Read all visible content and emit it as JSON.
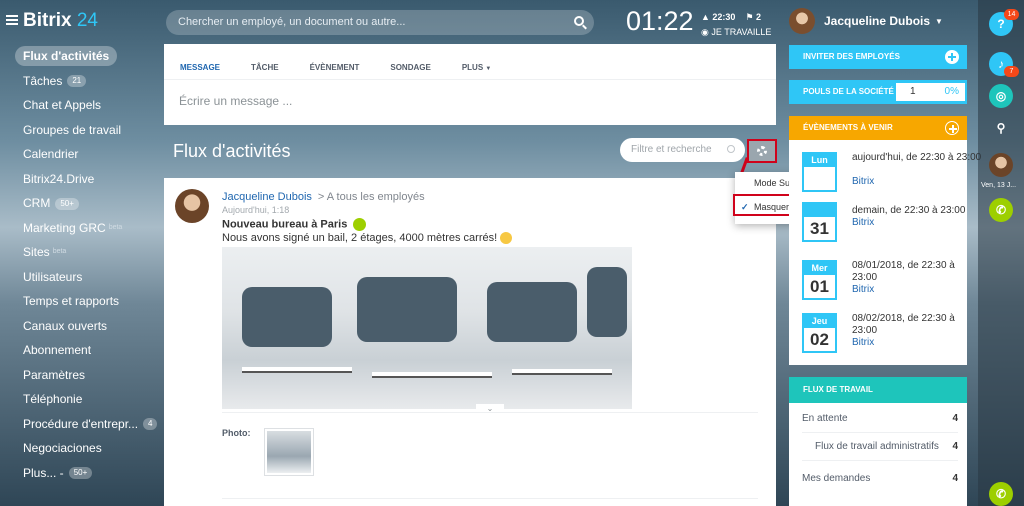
{
  "top": {
    "logo_name": "Bitrix",
    "logo_num": "24",
    "search_placeholder": "Chercher un employé, un document ou autre...",
    "clock": "01:22",
    "alarm_time": "22:30",
    "flags": "2",
    "work_status": "JE TRAVAILLE",
    "user_name": "Jacqueline Dubois"
  },
  "left_menu": [
    {
      "label": "Flux d'activités",
      "active": true
    },
    {
      "label": "Tâches",
      "count": "21"
    },
    {
      "label": "Chat et Appels"
    },
    {
      "label": "Groupes de travail"
    },
    {
      "label": "Calendrier"
    },
    {
      "label": "Bitrix24.Drive"
    },
    {
      "label": "CRM",
      "count": "50+"
    },
    {
      "label": "Marketing GRC",
      "beta": "beta"
    },
    {
      "label": "Sites",
      "beta": "beta"
    },
    {
      "label": "Utilisateurs"
    },
    {
      "label": "Temps et rapports"
    },
    {
      "label": "Canaux ouverts"
    },
    {
      "label": "Abonnement"
    },
    {
      "label": "Paramètres"
    },
    {
      "label": "Téléphonie"
    },
    {
      "label": "Procédure d'entrepr...",
      "count": "4"
    },
    {
      "label": "Negociaciones"
    },
    {
      "label": "Plus... -",
      "count": "50+"
    }
  ],
  "composer": {
    "tabs": [
      "MESSAGE",
      "TÂCHE",
      "ÉVÈNEMENT",
      "SONDAGE",
      "PLUS"
    ],
    "placeholder": "Écrire un message ..."
  },
  "feed": {
    "title": "Flux d'activités",
    "filter_placeholder": "Filtre et recherche"
  },
  "popup": {
    "item1": "Mode Suivi intelligent",
    "item2": "Masquer les tâches"
  },
  "post": {
    "author": "Jacqueline Dubois",
    "destination": "A tous les employés",
    "date": "Aujourd'hui, 1:18",
    "title": "Nouveau bureau à Paris",
    "text": "Nous avons signé un bail, 2 étages, 4000 mètres carrés!",
    "photo_label": "Photo:"
  },
  "right": {
    "invite": "INVITER DES EMPLOYÉS",
    "pouls": "POULS DE LA SOCIÉTÉ",
    "pouls_value": "1",
    "pouls_pct": "0%",
    "events_title": "ÉVÈNEMENTS À VENIR",
    "events": [
      {
        "day": "Lun",
        "num": "",
        "when": "aujourd'hui, de 22:30 à 23:00",
        "link": "Bitrix"
      },
      {
        "day": "",
        "num": "31",
        "when": "demain, de 22:30 à 23:00",
        "link": "Bitrix"
      },
      {
        "day": "Mer",
        "num": "01",
        "when": "08/01/2018, de 22:30 à 23:00",
        "link": "Bitrix"
      },
      {
        "day": "Jeu",
        "num": "02",
        "when": "08/02/2018, de 22:30 à 23:00",
        "link": "Bitrix"
      }
    ],
    "flux_title": "FLUX DE TRAVAIL",
    "flux_rows": [
      {
        "label": "En attente",
        "count": "4"
      },
      {
        "label": "Flux de travail administratifs",
        "count": "4"
      },
      {
        "label": "Mes demandes",
        "count": "4"
      }
    ]
  },
  "rail": {
    "help_badge": "14",
    "notif_badge": "7",
    "date": "Ven, 13 J..."
  },
  "colors": {
    "accent": "#2fc6f6",
    "orange": "#f7a700",
    "teal": "#1ec5bb",
    "highlight": "#d0021b",
    "link": "#2067b0"
  }
}
